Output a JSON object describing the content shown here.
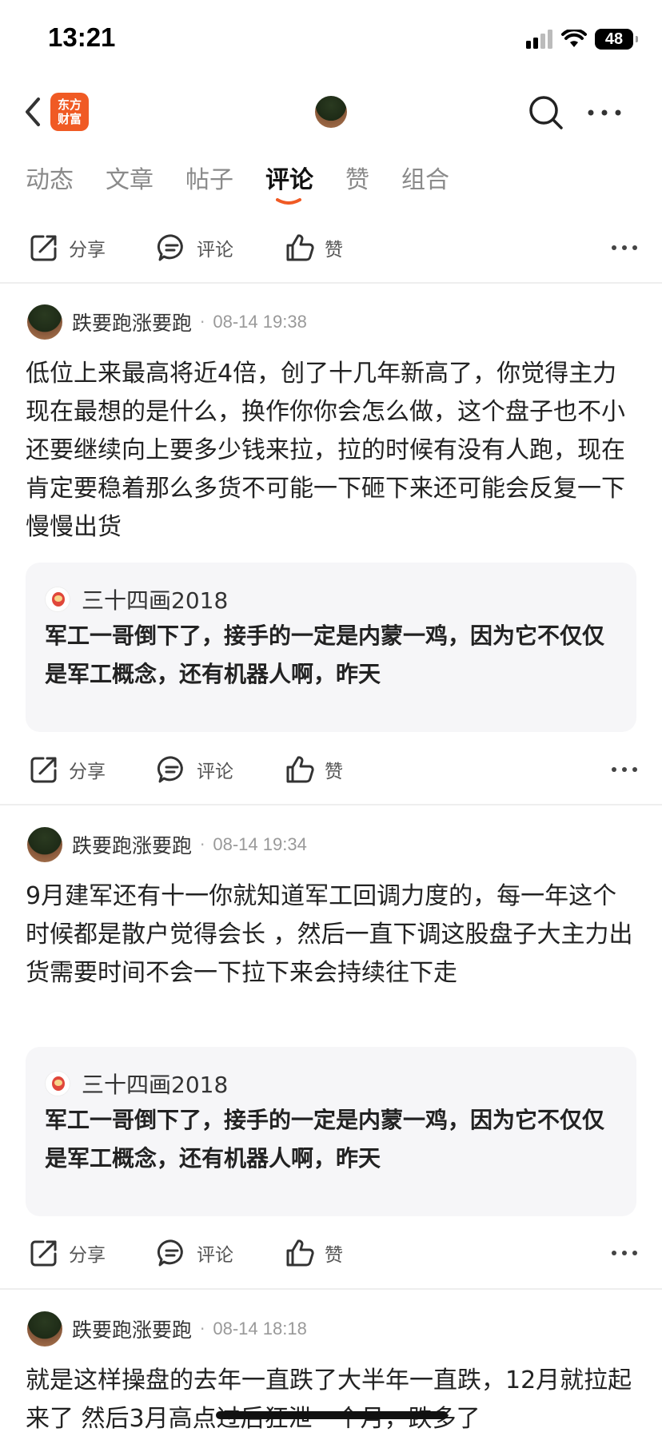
{
  "status": {
    "time": "13:21",
    "battery": "48"
  },
  "nav": {
    "logo_line1": "东方",
    "logo_line2": "财富"
  },
  "tabs": [
    "动态",
    "文章",
    "帖子",
    "评论",
    "赞",
    "组合"
  ],
  "actions": {
    "share": "分享",
    "comment": "评论",
    "like": "赞"
  },
  "posts": [
    {
      "author": "跌要跑涨要跑",
      "time": "08-14 19:38",
      "text": "低位上来最高将近4倍，创了十几年新高了，你觉得主力现在最想的是什么，换作你你会怎么做，这个盘子也不小还要继续向上要多少钱来拉，拉的时候有没有人跑，现在肯定要稳着那么多货不可能一下砸下来还可能会反复一下慢慢出货",
      "quote_user": "三十四画2018",
      "quote_text": "军工一哥倒下了，接手的一定是内蒙一鸡，因为它不仅仅是军工概念，还有机器人啊，昨天"
    },
    {
      "author": "跌要跑涨要跑",
      "time": "08-14 19:34",
      "text": "9月建军还有十一你就知道军工回调力度的，每一年这个时候都是散户觉得会长 ，然后一直下调这股盘子大主力出货需要时间不会一下拉下来会持续往下走",
      "quote_user": "三十四画2018",
      "quote_text": "军工一哥倒下了，接手的一定是内蒙一鸡，因为它不仅仅是军工概念，还有机器人啊，昨天"
    },
    {
      "author": "跌要跑涨要跑",
      "time": "08-14 18:18",
      "text": "就是这样操盘的去年一直跌了大半年一直跌，12月就拉起来了 然后3月高点过后狂泄一个月，跌多了"
    }
  ],
  "colors": {
    "accent": "#f05a24",
    "active_tab": "#111111",
    "inactive_tab": "#8a8a8a",
    "quote_bg": "#f6f6f8"
  }
}
